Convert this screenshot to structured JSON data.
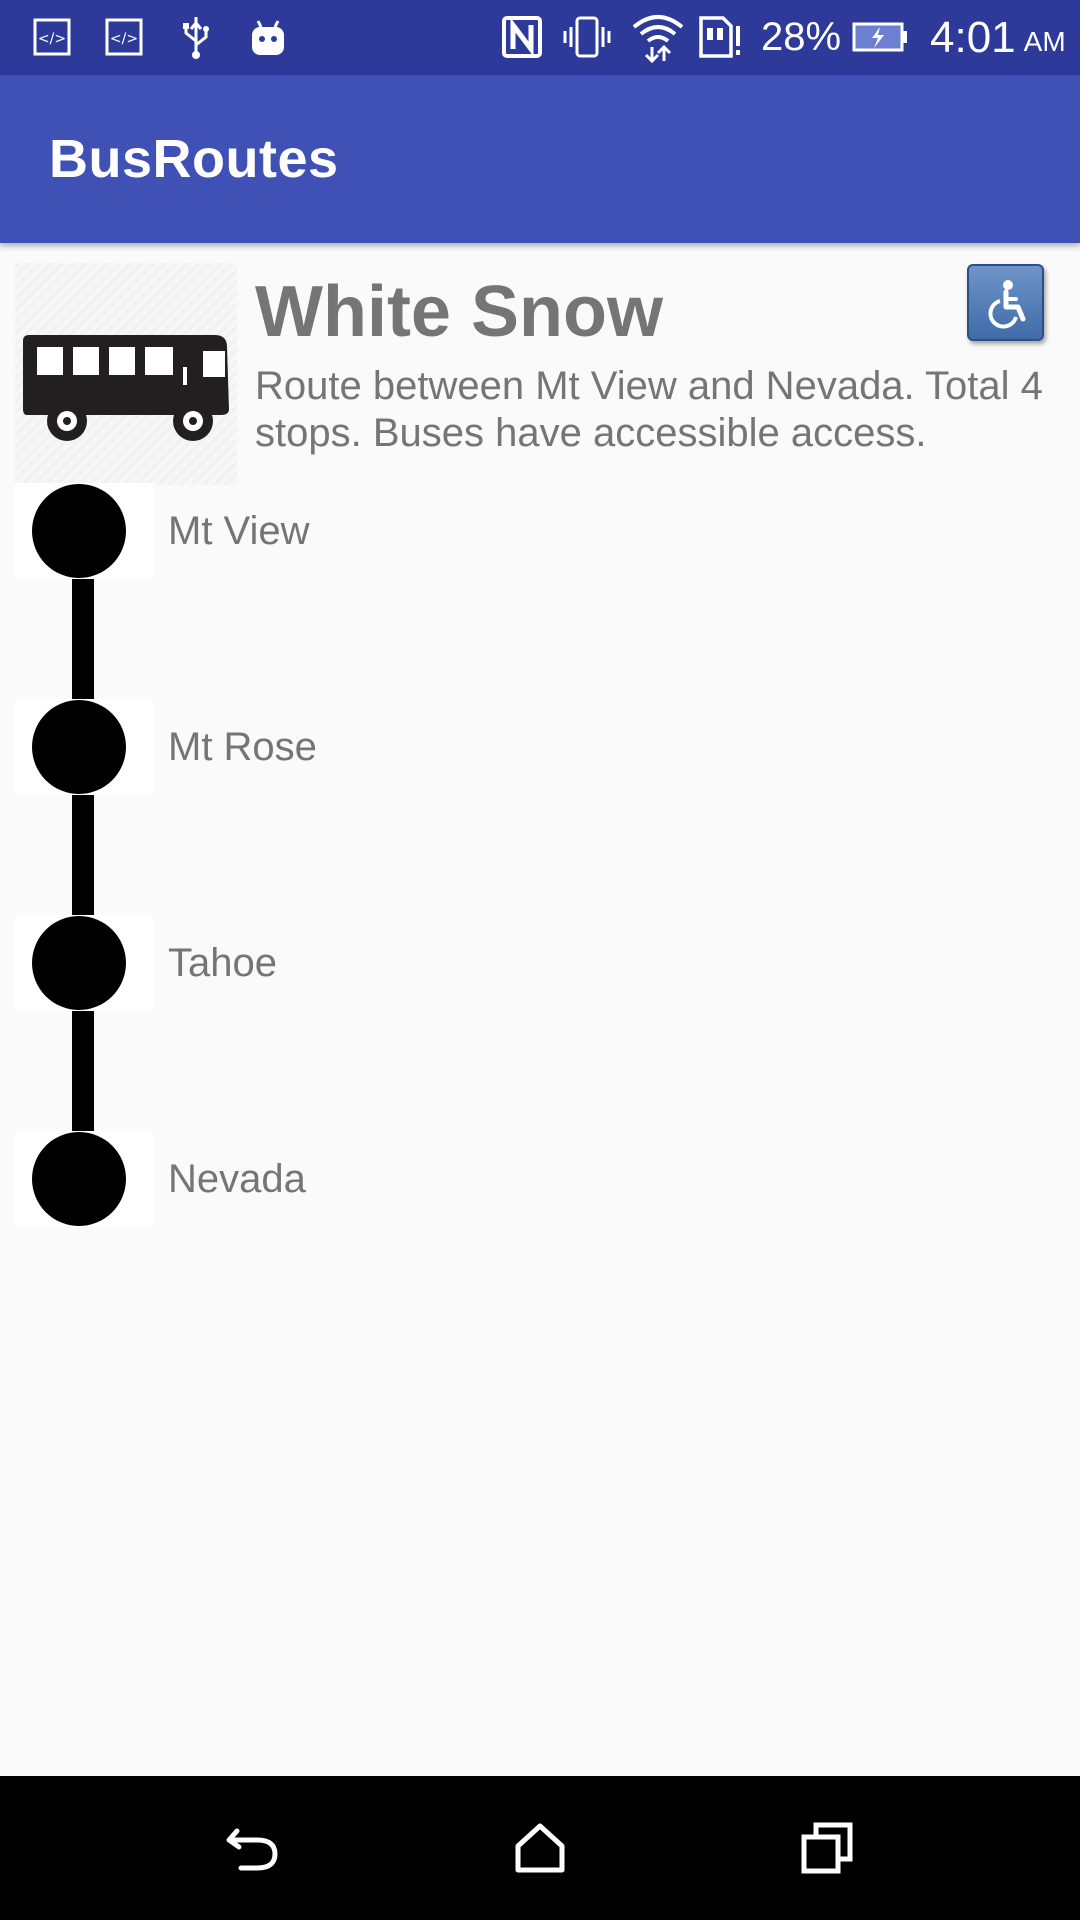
{
  "status_bar": {
    "icons": [
      "code-icon",
      "code-icon",
      "usb-icon",
      "android-icon",
      "nfc-icon",
      "vibrate-icon",
      "wifi-icon",
      "sim-alert-icon",
      "battery-charging-icon"
    ],
    "battery_percent": "28%",
    "time": "4:01",
    "am_pm": "AM"
  },
  "app_bar": {
    "title": "BusRoutes"
  },
  "route": {
    "name": "White Snow",
    "description": "Route between Mt View and Nevada. Total 4 stops. Buses have accessible access.",
    "image_icon": "bus-icon",
    "accessibility_icon": "wheelchair-icon",
    "accent_color": "#3f51b5",
    "status_color": "#2d3a9a"
  },
  "stops": [
    {
      "name": "Mt View"
    },
    {
      "name": "Mt Rose"
    },
    {
      "name": "Tahoe"
    },
    {
      "name": "Nevada"
    }
  ],
  "nav_bar": {
    "icons": [
      "back-icon",
      "home-icon",
      "recents-icon"
    ]
  }
}
